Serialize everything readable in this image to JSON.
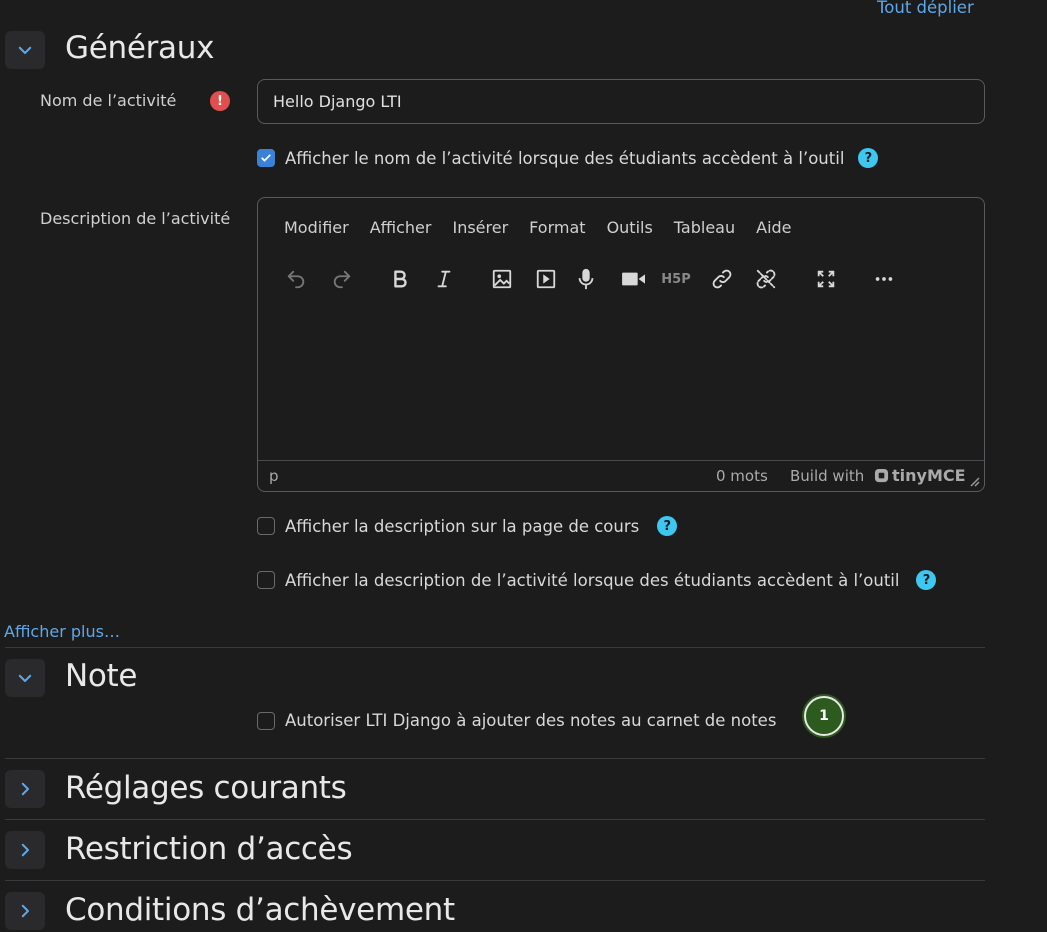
{
  "header": {
    "expand_all": "Tout déplier"
  },
  "sections": {
    "general": {
      "title": "Généraux"
    },
    "grade": {
      "title": "Note"
    },
    "common": {
      "title": "Réglages courants"
    },
    "access": {
      "title": "Restriction d’accès"
    },
    "completion": {
      "title": "Conditions d’achèvement"
    }
  },
  "form": {
    "name_label": "Nom de l’activité",
    "name_value": "Hello Django LTI",
    "show_name_label": "Afficher le nom de l’activité lorsque des étudiants accèdent à l’outil",
    "show_name_checked": true,
    "description_label": "Description de l’activité",
    "show_desc_course_label": "Afficher la description sur la page de cours",
    "show_desc_course_checked": false,
    "show_desc_tool_label": "Afficher la description de l’activité lorsque des étudiants accèdent à l’outil",
    "show_desc_tool_checked": false,
    "show_more": "Afficher plus…",
    "grade_label": "Autoriser LTI Django à ajouter des notes au carnet de notes",
    "grade_checked": false,
    "error_glyph": "!",
    "help_glyph": "?"
  },
  "editor": {
    "menu": [
      "Modifier",
      "Afficher",
      "Insérer",
      "Format",
      "Outils",
      "Tableau",
      "Aide"
    ],
    "toolbar_icons": [
      "undo-icon",
      "redo-icon",
      "bold-icon",
      "italic-icon",
      "image-icon",
      "media-icon",
      "microphone-icon",
      "video-camera-icon",
      "h5p-icon",
      "link-icon",
      "unlink-icon",
      "fullscreen-icon",
      "more-icon"
    ],
    "path": "p",
    "word_count": "0 mots",
    "build_with": "Build with",
    "brand": "tinyMCE"
  },
  "tour": {
    "step": "1"
  },
  "colors": {
    "accent": "#5fa8e8",
    "help": "#3cc8f0",
    "error": "#e04e4e",
    "badge": "#2d5a1e"
  }
}
